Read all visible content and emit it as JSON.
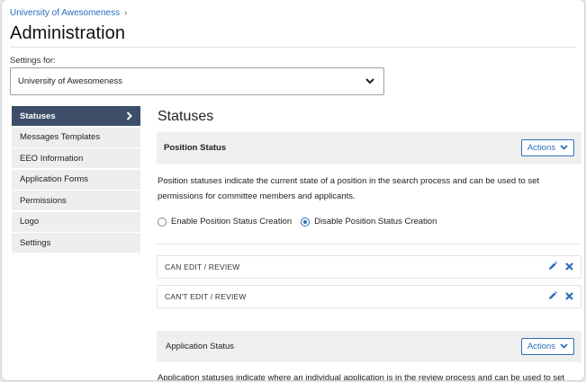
{
  "breadcrumb": {
    "item": "University of Awesomeness",
    "separator": "›"
  },
  "page_title": "Administration",
  "settings": {
    "label": "Settings for:",
    "selected": "University of Awesomeness"
  },
  "sidebar": {
    "items": [
      {
        "label": "Statuses",
        "active": true
      },
      {
        "label": "Messages Templates"
      },
      {
        "label": "EEO Information"
      },
      {
        "label": "Application Forms"
      },
      {
        "label": "Permissions"
      },
      {
        "label": "Logo"
      },
      {
        "label": "Settings"
      }
    ]
  },
  "main": {
    "title": "Statuses",
    "position_status": {
      "header": "Position Status",
      "actions_label": "Actions",
      "description": "Position statuses indicate the current state of a position in the search process and can be used to set permissions for committee members and applicants.",
      "radio_enable": "Enable Position Status Creation",
      "radio_disable": "Disable Position Status Creation",
      "selected": "disable",
      "rows": [
        {
          "label": "CAN EDIT / REVIEW"
        },
        {
          "label": "CAN'T EDIT / REVIEW"
        }
      ]
    },
    "application_status": {
      "header": "Application Status",
      "actions_label": "Actions",
      "description_partial": "Application statuses indicate where an individual application is in the review process and can be used to set"
    }
  },
  "colors": {
    "accent": "#2a6ebb",
    "sidebar_active": "#3d4f68",
    "panel_bg": "#efefef"
  }
}
